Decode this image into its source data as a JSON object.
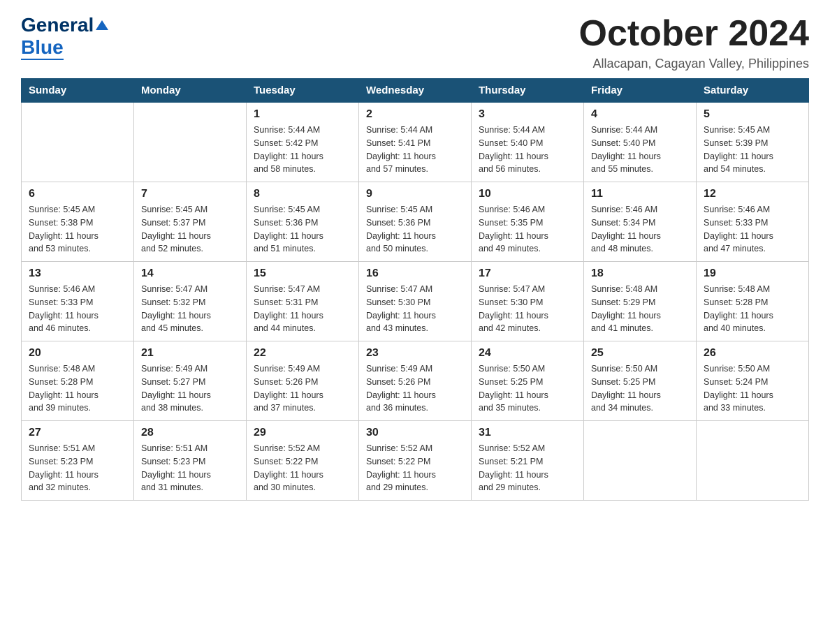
{
  "logo": {
    "general": "General",
    "blue": "Blue"
  },
  "header": {
    "month": "October 2024",
    "location": "Allacapan, Cagayan Valley, Philippines"
  },
  "weekdays": [
    "Sunday",
    "Monday",
    "Tuesday",
    "Wednesday",
    "Thursday",
    "Friday",
    "Saturday"
  ],
  "weeks": [
    [
      {
        "day": "",
        "info": ""
      },
      {
        "day": "",
        "info": ""
      },
      {
        "day": "1",
        "info": "Sunrise: 5:44 AM\nSunset: 5:42 PM\nDaylight: 11 hours\nand 58 minutes."
      },
      {
        "day": "2",
        "info": "Sunrise: 5:44 AM\nSunset: 5:41 PM\nDaylight: 11 hours\nand 57 minutes."
      },
      {
        "day": "3",
        "info": "Sunrise: 5:44 AM\nSunset: 5:40 PM\nDaylight: 11 hours\nand 56 minutes."
      },
      {
        "day": "4",
        "info": "Sunrise: 5:44 AM\nSunset: 5:40 PM\nDaylight: 11 hours\nand 55 minutes."
      },
      {
        "day": "5",
        "info": "Sunrise: 5:45 AM\nSunset: 5:39 PM\nDaylight: 11 hours\nand 54 minutes."
      }
    ],
    [
      {
        "day": "6",
        "info": "Sunrise: 5:45 AM\nSunset: 5:38 PM\nDaylight: 11 hours\nand 53 minutes."
      },
      {
        "day": "7",
        "info": "Sunrise: 5:45 AM\nSunset: 5:37 PM\nDaylight: 11 hours\nand 52 minutes."
      },
      {
        "day": "8",
        "info": "Sunrise: 5:45 AM\nSunset: 5:36 PM\nDaylight: 11 hours\nand 51 minutes."
      },
      {
        "day": "9",
        "info": "Sunrise: 5:45 AM\nSunset: 5:36 PM\nDaylight: 11 hours\nand 50 minutes."
      },
      {
        "day": "10",
        "info": "Sunrise: 5:46 AM\nSunset: 5:35 PM\nDaylight: 11 hours\nand 49 minutes."
      },
      {
        "day": "11",
        "info": "Sunrise: 5:46 AM\nSunset: 5:34 PM\nDaylight: 11 hours\nand 48 minutes."
      },
      {
        "day": "12",
        "info": "Sunrise: 5:46 AM\nSunset: 5:33 PM\nDaylight: 11 hours\nand 47 minutes."
      }
    ],
    [
      {
        "day": "13",
        "info": "Sunrise: 5:46 AM\nSunset: 5:33 PM\nDaylight: 11 hours\nand 46 minutes."
      },
      {
        "day": "14",
        "info": "Sunrise: 5:47 AM\nSunset: 5:32 PM\nDaylight: 11 hours\nand 45 minutes."
      },
      {
        "day": "15",
        "info": "Sunrise: 5:47 AM\nSunset: 5:31 PM\nDaylight: 11 hours\nand 44 minutes."
      },
      {
        "day": "16",
        "info": "Sunrise: 5:47 AM\nSunset: 5:30 PM\nDaylight: 11 hours\nand 43 minutes."
      },
      {
        "day": "17",
        "info": "Sunrise: 5:47 AM\nSunset: 5:30 PM\nDaylight: 11 hours\nand 42 minutes."
      },
      {
        "day": "18",
        "info": "Sunrise: 5:48 AM\nSunset: 5:29 PM\nDaylight: 11 hours\nand 41 minutes."
      },
      {
        "day": "19",
        "info": "Sunrise: 5:48 AM\nSunset: 5:28 PM\nDaylight: 11 hours\nand 40 minutes."
      }
    ],
    [
      {
        "day": "20",
        "info": "Sunrise: 5:48 AM\nSunset: 5:28 PM\nDaylight: 11 hours\nand 39 minutes."
      },
      {
        "day": "21",
        "info": "Sunrise: 5:49 AM\nSunset: 5:27 PM\nDaylight: 11 hours\nand 38 minutes."
      },
      {
        "day": "22",
        "info": "Sunrise: 5:49 AM\nSunset: 5:26 PM\nDaylight: 11 hours\nand 37 minutes."
      },
      {
        "day": "23",
        "info": "Sunrise: 5:49 AM\nSunset: 5:26 PM\nDaylight: 11 hours\nand 36 minutes."
      },
      {
        "day": "24",
        "info": "Sunrise: 5:50 AM\nSunset: 5:25 PM\nDaylight: 11 hours\nand 35 minutes."
      },
      {
        "day": "25",
        "info": "Sunrise: 5:50 AM\nSunset: 5:25 PM\nDaylight: 11 hours\nand 34 minutes."
      },
      {
        "day": "26",
        "info": "Sunrise: 5:50 AM\nSunset: 5:24 PM\nDaylight: 11 hours\nand 33 minutes."
      }
    ],
    [
      {
        "day": "27",
        "info": "Sunrise: 5:51 AM\nSunset: 5:23 PM\nDaylight: 11 hours\nand 32 minutes."
      },
      {
        "day": "28",
        "info": "Sunrise: 5:51 AM\nSunset: 5:23 PM\nDaylight: 11 hours\nand 31 minutes."
      },
      {
        "day": "29",
        "info": "Sunrise: 5:52 AM\nSunset: 5:22 PM\nDaylight: 11 hours\nand 30 minutes."
      },
      {
        "day": "30",
        "info": "Sunrise: 5:52 AM\nSunset: 5:22 PM\nDaylight: 11 hours\nand 29 minutes."
      },
      {
        "day": "31",
        "info": "Sunrise: 5:52 AM\nSunset: 5:21 PM\nDaylight: 11 hours\nand 29 minutes."
      },
      {
        "day": "",
        "info": ""
      },
      {
        "day": "",
        "info": ""
      }
    ]
  ]
}
